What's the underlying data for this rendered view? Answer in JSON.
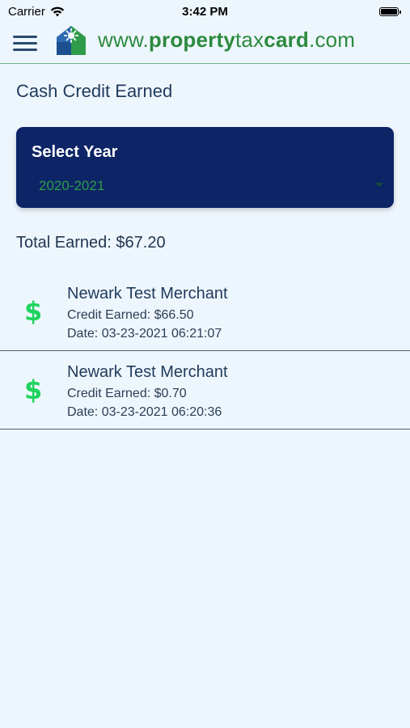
{
  "status": {
    "carrier": "Carrier",
    "time": "3:42 PM"
  },
  "header": {
    "brand_prefix": "www.",
    "brand_bold1": "property",
    "brand_mid": "tax",
    "brand_bold2": "card",
    "brand_suffix": ".com"
  },
  "page": {
    "title": "Cash Credit Earned"
  },
  "year_selector": {
    "label": "Select Year",
    "value": "2020-2021"
  },
  "total": {
    "text": "Total Earned: $67.20"
  },
  "transactions": [
    {
      "icon": "$",
      "merchant": "Newark Test Merchant",
      "credit": "Credit Earned: $66.50",
      "date": "Date: 03-23-2021 06:21:07"
    },
    {
      "icon": "$",
      "merchant": "Newark Test Merchant",
      "credit": "Credit Earned: $0.70",
      "date": "Date: 03-23-2021 06:20:36"
    }
  ],
  "colors": {
    "background": "#eef6fd",
    "card": "#0d2466",
    "brand_green": "#2c8a3e",
    "dollar_green": "#1fd35f"
  }
}
